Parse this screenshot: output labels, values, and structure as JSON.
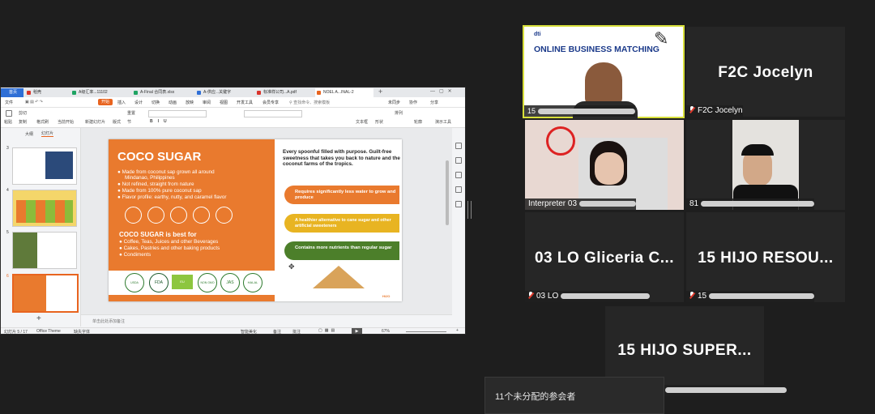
{
  "app": {
    "tabs": [
      {
        "label": "首页",
        "color": "#2f6fd6"
      },
      {
        "label": "稻壳",
        "color": "#d9342b"
      },
      {
        "label": "A级汇率...11102",
        "color": "#1fa463"
      },
      {
        "label": "A-Final 合同表.xlsx",
        "color": "#1fa463"
      },
      {
        "label": "A-供应...关键字",
        "color": "#2f6fd6"
      },
      {
        "label": "标准样公司...A.pdf",
        "color": "#d9342b"
      },
      {
        "label": "NOEL A...INAL-2",
        "color": "#e8641f"
      }
    ],
    "menus": [
      "文件",
      "开始",
      "插入",
      "设计",
      "切换",
      "动画",
      "放映",
      "审阅",
      "视图",
      "开发工具",
      "会员专享"
    ],
    "active_menu": "开始",
    "search_label": "查找命令、搜索模板",
    "right_menu": [
      "未同步",
      "协作",
      "分享"
    ],
    "toolbar_labels": [
      "粘贴",
      "剪切",
      "复制",
      "格式刷",
      "当前开始",
      "新建幻灯片",
      "版式",
      "重置",
      "节",
      "文本框",
      "形状",
      "排列",
      "轮廓",
      "演示工具"
    ],
    "pane_tabs": [
      "大纲",
      "幻灯片"
    ],
    "thumb_numbers": [
      "3",
      "4",
      "5",
      "6"
    ],
    "notes_placeholder": "单击此处添加备注",
    "status": {
      "slide_pos": "幻灯片 5 / 17",
      "theme": "Office Theme",
      "missing_font": "缺失字体",
      "smart_beautify": "智能美化",
      "notes": "备注",
      "comments": "批注",
      "zoom": "67%"
    }
  },
  "slide": {
    "title": "COCO SUGAR",
    "bullets": [
      "Made from coconut sap grown all around",
      "Mindanao, Philippines",
      "Not refined, straight from nature",
      "Made from 100% pure coconut sap",
      "Flavor profile: earthy, nutty, and caramel flavor"
    ],
    "subtitle": "COCO SUGAR is best for",
    "uses": [
      "Coffee, Teas, Juices and other Beverages",
      "Cakes, Pastries and other baking products",
      "Condiments"
    ],
    "tagline": "Every spoonful filled with purpose. Guilt-free sweetness that takes you back to nature and the coconut farms of the tropics.",
    "pills": [
      {
        "text": "Requires significantly less water to grow and produce",
        "color": "#e97a2e"
      },
      {
        "text": "A healthier alternative to cane sugar and other artificial sweeteners",
        "color": "#e8b422"
      },
      {
        "text": "Contains more nutrients than regular sugar",
        "color": "#4c7f2a"
      }
    ],
    "certs": [
      "USDA ORGANIC",
      "FDA",
      "EU",
      "NON GMO",
      "JAS",
      "HALAL"
    ],
    "brand": "HIJO"
  },
  "meeting": {
    "banner_title": "ONLINE BUSINESS MATCHING",
    "banner_org": "dti",
    "tiles": [
      {
        "big": "",
        "label": "15"
      },
      {
        "big": "F2C Jocelyn",
        "label": "F2C Jocelyn"
      },
      {
        "big": "",
        "label": "Interpreter 03"
      },
      {
        "big": "",
        "label": "81"
      },
      {
        "big": "03 LO Gliceria C...",
        "label": "03 LO"
      },
      {
        "big": "15 HIJO RESOU...",
        "label": "15"
      },
      {
        "big": "15 HIJO SUPER...",
        "label": ""
      }
    ],
    "unassigned": "11个未分配的参会者"
  }
}
